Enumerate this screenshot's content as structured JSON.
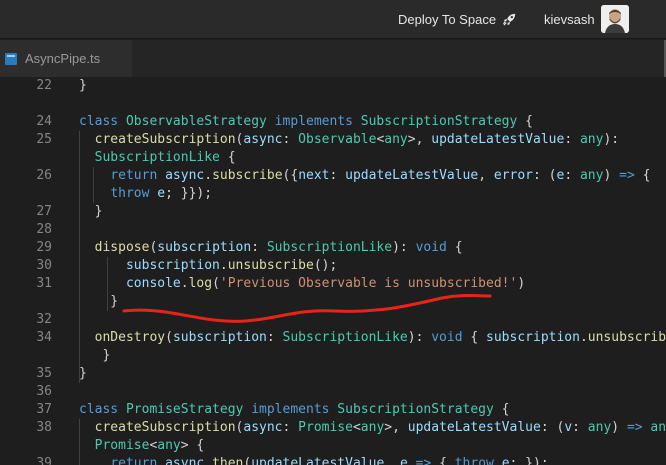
{
  "topbar": {
    "deploy_label": "Deploy To Space",
    "deploy_icon": "rocket-icon",
    "username": "kievsash"
  },
  "tab": {
    "label": "AsyncPipe.ts",
    "icon": "typescript-file-icon"
  },
  "editor": {
    "lines": [
      {
        "num": "22",
        "tokens": [
          [
            "pl",
            "}"
          ]
        ]
      },
      {
        "num": "",
        "tokens": []
      },
      {
        "num": "24",
        "tokens": [
          [
            "kw",
            "class "
          ],
          [
            "ty",
            "ObservableStrategy"
          ],
          [
            "kw",
            " implements "
          ],
          [
            "ty",
            "SubscriptionStrategy"
          ],
          [
            "pl",
            " {"
          ]
        ]
      },
      {
        "num": "25",
        "tokens": [
          [
            "pl",
            "  "
          ],
          [
            "fn",
            "createSubscription"
          ],
          [
            "pl",
            "("
          ],
          [
            "vr",
            "async"
          ],
          [
            "pl",
            ": "
          ],
          [
            "ty",
            "Observable"
          ],
          [
            "pl",
            "<"
          ],
          [
            "ty",
            "any"
          ],
          [
            "pl",
            ">, "
          ],
          [
            "vr",
            "updateLatestValue"
          ],
          [
            "pl",
            ": "
          ],
          [
            "ty",
            "any"
          ],
          [
            "pl",
            "):"
          ]
        ]
      },
      {
        "num": "",
        "tokens": [
          [
            "pl",
            "  "
          ],
          [
            "ty",
            "SubscriptionLike"
          ],
          [
            "pl",
            " {"
          ]
        ]
      },
      {
        "num": "26",
        "tokens": [
          [
            "pl",
            "    "
          ],
          [
            "kw",
            "return "
          ],
          [
            "vr",
            "async"
          ],
          [
            "pl",
            "."
          ],
          [
            "fn",
            "subscribe"
          ],
          [
            "pl",
            "({"
          ],
          [
            "vr",
            "next"
          ],
          [
            "pl",
            ": "
          ],
          [
            "vr",
            "updateLatestValue"
          ],
          [
            "pl",
            ", "
          ],
          [
            "vr",
            "error"
          ],
          [
            "pl",
            ": ("
          ],
          [
            "vr",
            "e"
          ],
          [
            "pl",
            ": "
          ],
          [
            "ty",
            "any"
          ],
          [
            "pl",
            ") "
          ],
          [
            "kw",
            "=>"
          ],
          [
            "pl",
            " {"
          ]
        ]
      },
      {
        "num": "",
        "tokens": [
          [
            "pl",
            "    "
          ],
          [
            "kw",
            "throw "
          ],
          [
            "vr",
            "e"
          ],
          [
            "pl",
            "; }});"
          ]
        ]
      },
      {
        "num": "27",
        "tokens": [
          [
            "pl",
            "  }"
          ]
        ]
      },
      {
        "num": "28",
        "tokens": []
      },
      {
        "num": "29",
        "tokens": [
          [
            "pl",
            "  "
          ],
          [
            "fn",
            "dispose"
          ],
          [
            "pl",
            "("
          ],
          [
            "vr",
            "subscription"
          ],
          [
            "pl",
            ": "
          ],
          [
            "ty",
            "SubscriptionLike"
          ],
          [
            "pl",
            "): "
          ],
          [
            "kw",
            "void"
          ],
          [
            "pl",
            " {"
          ]
        ]
      },
      {
        "num": "30",
        "tokens": [
          [
            "pl",
            "      "
          ],
          [
            "vr",
            "subscription"
          ],
          [
            "pl",
            "."
          ],
          [
            "fn",
            "unsubscribe"
          ],
          [
            "pl",
            "();"
          ]
        ]
      },
      {
        "num": "31",
        "tokens": [
          [
            "pl",
            "      "
          ],
          [
            "vr",
            "console"
          ],
          [
            "pl",
            "."
          ],
          [
            "fn",
            "log"
          ],
          [
            "pl",
            "("
          ],
          [
            "st",
            "'Previous Observable is unsubscribed!'"
          ],
          [
            "pl",
            ")"
          ]
        ]
      },
      {
        "num": "",
        "tokens": [
          [
            "pl",
            "    }"
          ]
        ]
      },
      {
        "num": "32",
        "tokens": []
      },
      {
        "num": "34",
        "tokens": [
          [
            "pl",
            "  "
          ],
          [
            "fn",
            "onDestroy"
          ],
          [
            "pl",
            "("
          ],
          [
            "vr",
            "subscription"
          ],
          [
            "pl",
            ": "
          ],
          [
            "ty",
            "SubscriptionLike"
          ],
          [
            "pl",
            "): "
          ],
          [
            "kw",
            "void"
          ],
          [
            "pl",
            " { "
          ],
          [
            "vr",
            "subscription"
          ],
          [
            "pl",
            "."
          ],
          [
            "fn",
            "unsubscribe"
          ],
          [
            "pl",
            "();"
          ]
        ]
      },
      {
        "num": "",
        "tokens": [
          [
            "pl",
            "   }"
          ]
        ]
      },
      {
        "num": "35",
        "tokens": [
          [
            "pl",
            "}"
          ]
        ]
      },
      {
        "num": "36",
        "tokens": []
      },
      {
        "num": "37",
        "tokens": [
          [
            "kw",
            "class "
          ],
          [
            "ty",
            "PromiseStrategy"
          ],
          [
            "kw",
            " implements "
          ],
          [
            "ty",
            "SubscriptionStrategy"
          ],
          [
            "pl",
            " {"
          ]
        ]
      },
      {
        "num": "38",
        "tokens": [
          [
            "pl",
            "  "
          ],
          [
            "fn",
            "createSubscription"
          ],
          [
            "pl",
            "("
          ],
          [
            "vr",
            "async"
          ],
          [
            "pl",
            ": "
          ],
          [
            "ty",
            "Promise"
          ],
          [
            "pl",
            "<"
          ],
          [
            "ty",
            "any"
          ],
          [
            "pl",
            ">, "
          ],
          [
            "vr",
            "updateLatestValue"
          ],
          [
            "pl",
            ": ("
          ],
          [
            "vr",
            "v"
          ],
          [
            "pl",
            ": "
          ],
          [
            "ty",
            "any"
          ],
          [
            "pl",
            ") "
          ],
          [
            "kw",
            "=>"
          ],
          [
            "pl",
            " "
          ],
          [
            "ty",
            "any"
          ],
          [
            "pl",
            "):"
          ]
        ]
      },
      {
        "num": "",
        "tokens": [
          [
            "pl",
            "  "
          ],
          [
            "ty",
            "Promise"
          ],
          [
            "pl",
            "<"
          ],
          [
            "ty",
            "any"
          ],
          [
            "pl",
            "> {"
          ]
        ]
      },
      {
        "num": "39",
        "tokens": [
          [
            "pl",
            "    "
          ],
          [
            "kw",
            "return "
          ],
          [
            "vr",
            "async"
          ],
          [
            "pl",
            "."
          ],
          [
            "fn",
            "then"
          ],
          [
            "pl",
            "("
          ],
          [
            "vr",
            "updateLatestValue"
          ],
          [
            "pl",
            ", "
          ],
          [
            "vr",
            "e"
          ],
          [
            "pl",
            " "
          ],
          [
            "kw",
            "=>"
          ],
          [
            "pl",
            " { "
          ],
          [
            "kw",
            "throw "
          ],
          [
            "vr",
            "e"
          ],
          [
            "pl",
            "; });"
          ]
        ]
      }
    ]
  },
  "colors": {
    "annotation": "#e8241a",
    "background": "#1e1e1e",
    "topbar": "#2a2a2b"
  }
}
